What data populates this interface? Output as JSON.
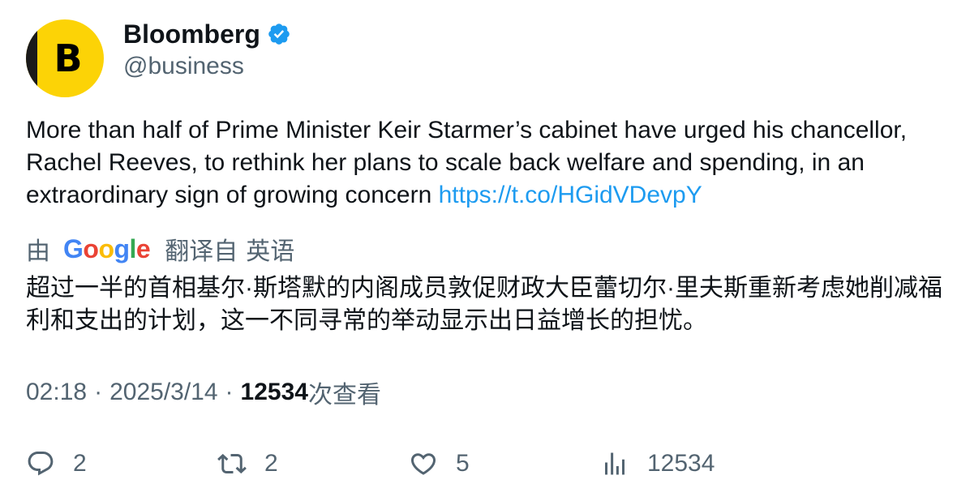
{
  "author": {
    "display_name": "Bloomberg",
    "handle": "@business",
    "avatar_letter": "B",
    "avatar_color": "#fcd306",
    "verified": true,
    "verified_color": "#1d9bf0"
  },
  "tweet": {
    "text": "More than half of Prime Minister Keir Starmer’s cabinet have urged his chancellor, Rachel Reeves, to rethink her plans to scale back welfare and spending, in an extraordinary sign of growing concern ",
    "link": "https://t.co/HGidVDevpY"
  },
  "translation": {
    "by_label": "由",
    "google_letters": [
      "G",
      "o",
      "o",
      "g",
      "l",
      "e"
    ],
    "translated_from": "翻译自",
    "language": "英语",
    "text": "超过一半的首相基尔·斯塔默的内阁成员敦促财政大臣蕾切尔·里夫斯重新考虑她削减福利和支出的计划，这一不同寻常的举动显示出日益增长的担忧。"
  },
  "meta": {
    "time": "02:18",
    "separator": "·",
    "date": "2025/3/14",
    "views_count": "12534",
    "views_label": "次查看"
  },
  "actions": {
    "reply": {
      "icon": "reply-icon",
      "count": "2"
    },
    "retweet": {
      "icon": "retweet-icon",
      "count": "2"
    },
    "like": {
      "icon": "heart-icon",
      "count": "5"
    },
    "views": {
      "icon": "analytics-icon",
      "count": "12534"
    }
  },
  "colors": {
    "text_primary": "#0f1419",
    "text_secondary": "#536471",
    "link": "#1d9bf0"
  }
}
